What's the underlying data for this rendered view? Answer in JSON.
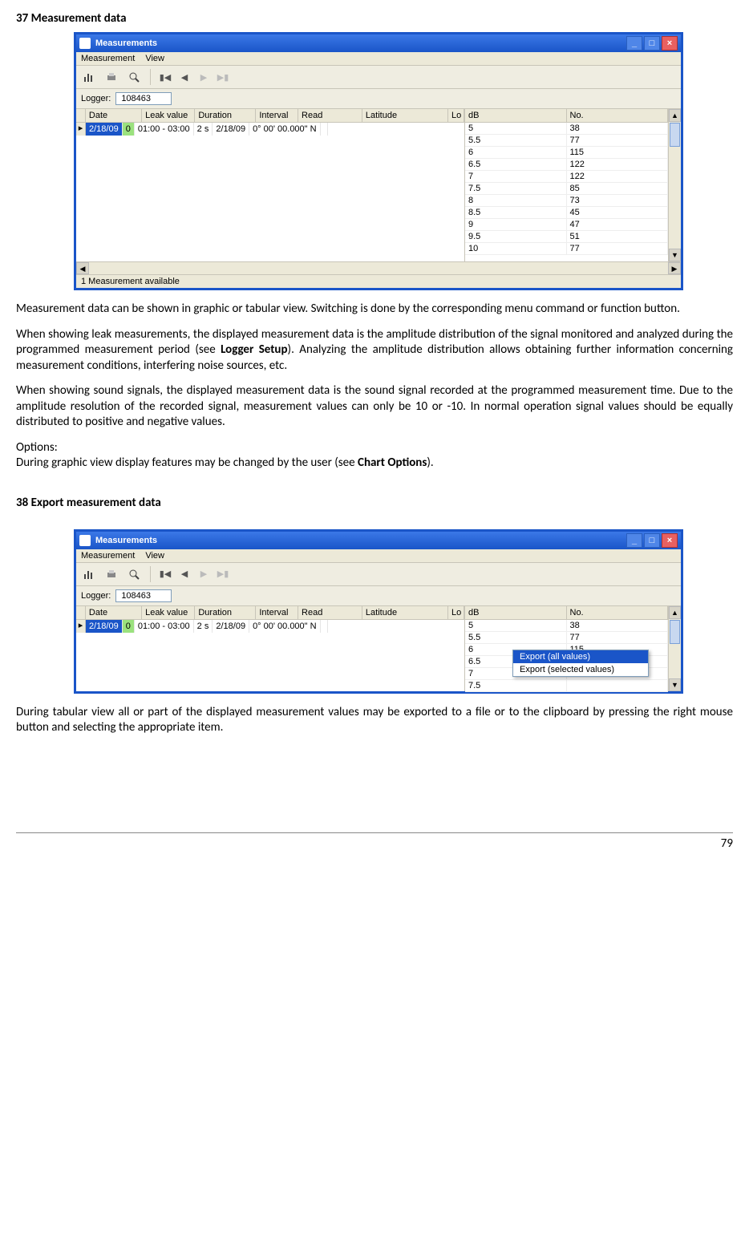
{
  "section37": {
    "num": "37",
    "title": "Measurement data"
  },
  "section38": {
    "num": "38",
    "title": "Export measurement data"
  },
  "win": {
    "title": "Measurements",
    "menu": {
      "m1": "Measurement",
      "m2": "View"
    },
    "loggerLabel": "Logger:",
    "loggerValue": "108463",
    "status": "1 Measurement available"
  },
  "cols": {
    "date": "Date",
    "lv": "Leak value",
    "dur": "Duration",
    "int": "Interval",
    "rd": "Read",
    "lat": "Latitude",
    "lo": "Lo",
    "db": "dB",
    "no": "No."
  },
  "row": {
    "date": "2/18/09",
    "lv": "0",
    "dur": "01:00 - 03:00",
    "int": "2 s",
    "rd": "2/18/09",
    "lat": "0° 00' 00.000\" N"
  },
  "dbdata": [
    {
      "db": "5",
      "no": "38"
    },
    {
      "db": "5.5",
      "no": "77"
    },
    {
      "db": "6",
      "no": "115"
    },
    {
      "db": "6.5",
      "no": "122"
    },
    {
      "db": "7",
      "no": "122"
    },
    {
      "db": "7.5",
      "no": "85"
    },
    {
      "db": "8",
      "no": "73"
    },
    {
      "db": "8.5",
      "no": "45"
    },
    {
      "db": "9",
      "no": "47"
    },
    {
      "db": "9.5",
      "no": "51"
    },
    {
      "db": "10",
      "no": "77"
    }
  ],
  "dbdata2": [
    {
      "db": "5",
      "no": "38"
    },
    {
      "db": "5.5",
      "no": "77"
    },
    {
      "db": "6",
      "no": "115"
    },
    {
      "db": "6.5",
      "no": "122"
    },
    {
      "db": "7",
      "no": ""
    },
    {
      "db": "7.5",
      "no": ""
    }
  ],
  "ctx": {
    "all": "Export (all values)",
    "sel": "Export (selected values)"
  },
  "para1": "Measurement data can be shown in graphic or tabular view. Switching is done by the corresponding menu command or function button.",
  "para2a": "When showing leak measurements, the displayed measurement data is the amplitude distribution of the signal monitored and analyzed during the programmed measurement period (see ",
  "para2b": "Logger Setup",
  "para2c": "). Analyzing the amplitude distribution allows obtaining further information concerning measurement conditions, interfering noise sources, etc.",
  "para3": "When showing sound signals, the displayed measurement data is the sound signal recorded at the programmed measurement time. Due to the amplitude resolution of the recorded signal, measurement values can only be 10 or -10. In normal operation signal values should be equally distributed to positive and negative values.",
  "optlabel": "Options:",
  "para4a": "During graphic view display features may be changed by the user (see ",
  "para4b": "Chart Options",
  "para4c": ").",
  "para5": "During tabular view all or part of the displayed measurement values may be exported to a file or to the clipboard by pressing the right mouse button and selecting the appropriate item.",
  "page": "79"
}
